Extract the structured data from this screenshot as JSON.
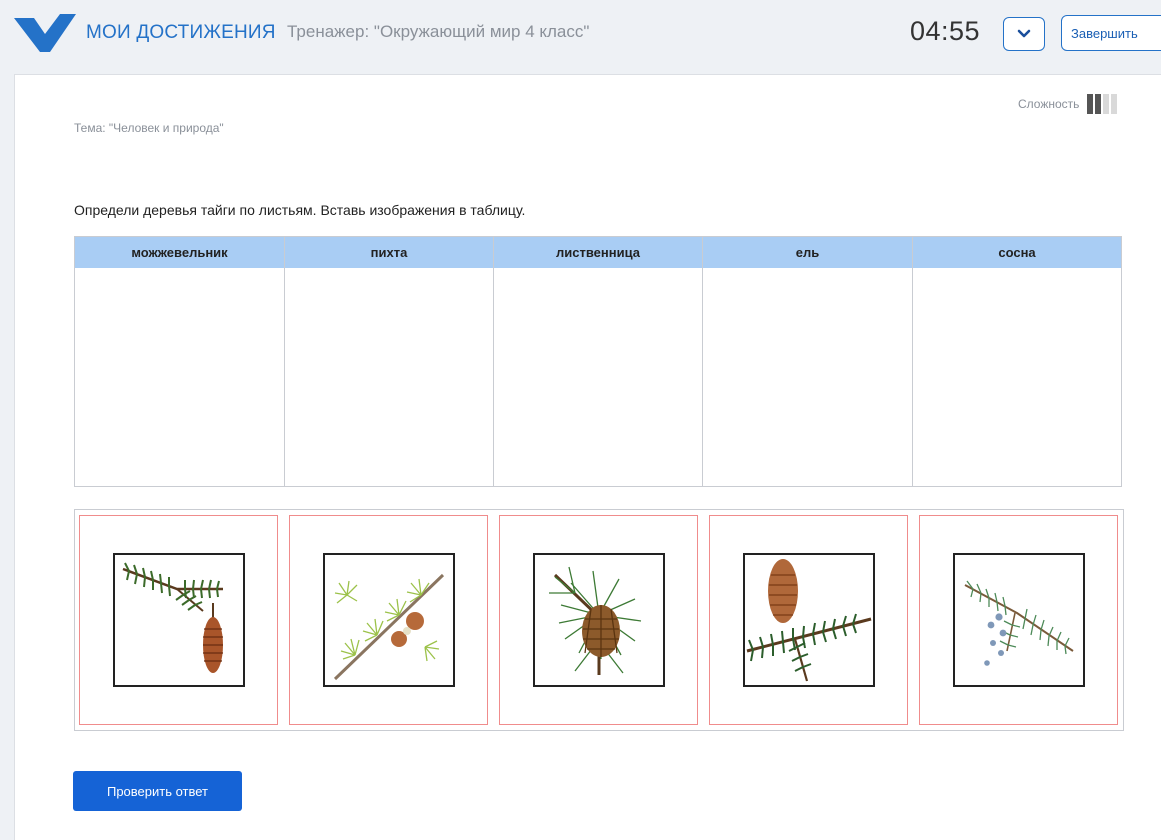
{
  "header": {
    "brand": "МОИ ДОСТИЖЕНИЯ",
    "trainer_title": "Тренажер: \"Окружающий мир 4 класс\"",
    "timer": "04:55",
    "finish_label": "Завершить",
    "brand_color": "#2472c8"
  },
  "content": {
    "difficulty_label": "Сложность",
    "difficulty_level": {
      "filled": 2,
      "total": 4
    },
    "topic": "Тема: \"Человек и природа\"",
    "task": "Определи деревья тайги по листьям. Вставь изображения в таблицу."
  },
  "table": {
    "columns": [
      "можжевельник",
      "пихта",
      "лиственница",
      "ель",
      "сосна"
    ],
    "header_color": "#a9cdf4"
  },
  "tray": {
    "items": [
      {
        "icon": "fir-branch-cone-icon"
      },
      {
        "icon": "larch-branch-icon"
      },
      {
        "icon": "pine-branch-cone-icon"
      },
      {
        "icon": "spruce-branch-cone-icon"
      },
      {
        "icon": "juniper-branch-icon"
      }
    ],
    "tile_border_color": "#f08c8c"
  },
  "check_button_label": "Проверить ответ",
  "button_color": "#1563d6"
}
